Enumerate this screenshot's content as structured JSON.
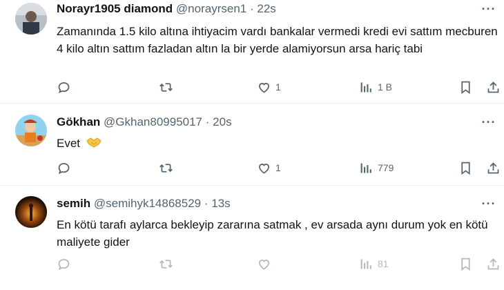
{
  "tweets": [
    {
      "name": "Norayr1905 diamond",
      "handle": "@norayrsen1",
      "time": "22s",
      "sep": "·",
      "text": "Zamanında 1.5 kilo altına ihtiyacim vardı bankalar vermedi kredi evi sattım mecburen 4 kilo altın sattım fazladan altın la bir yerde alamiyorsun arsa hariç tabi",
      "likes": "1",
      "views": "1 B",
      "more": "···"
    },
    {
      "name": "Gökhan",
      "handle": "@Gkhan80995017",
      "time": "20s",
      "sep": "·",
      "text": "Evet",
      "likes": "1",
      "views": "779",
      "more": "···"
    },
    {
      "name": "semih",
      "handle": "@semihyk14868529",
      "time": "13s",
      "sep": "·",
      "text": "En kötü tarafı aylarca bekleyip zararına satmak , ev arsada aynı durum yok en kötü maliyete gider",
      "likes": "",
      "views": "81",
      "more": "···"
    }
  ],
  "icons": {
    "reply": "reply-icon",
    "retweet": "retweet-icon",
    "like": "heart-icon",
    "views": "views-icon",
    "bookmark": "bookmark-icon",
    "share": "share-icon"
  },
  "colors": {
    "text": "#0f1419",
    "secondary": "#536471",
    "divider": "#eff3f4"
  }
}
